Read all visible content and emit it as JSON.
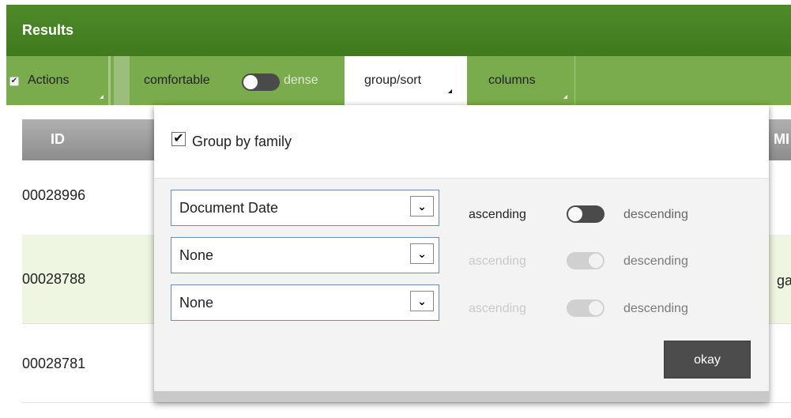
{
  "header": {
    "title": "Results"
  },
  "toolbar": {
    "actions_label": "Actions",
    "density_left": "comfortable",
    "density_right": "dense",
    "tab_group_sort": "group/sort",
    "tab_columns": "columns"
  },
  "table": {
    "id_header": "ID",
    "right_header_partial": "MI",
    "rows": [
      {
        "id": "00028996"
      },
      {
        "id": "00028788",
        "right_partial": "ga"
      },
      {
        "id": "00028781"
      }
    ]
  },
  "popup": {
    "group_by_family": {
      "label": "Group by family",
      "checked": true
    },
    "sort_levels": [
      {
        "field": "Document Date",
        "ascending_label": "ascending",
        "descending_label": "descending",
        "enabled": true
      },
      {
        "field": "None",
        "ascending_label": "ascending",
        "descending_label": "descending",
        "enabled": false
      },
      {
        "field": "None",
        "ascending_label": "ascending",
        "descending_label": "descending",
        "enabled": false
      }
    ],
    "okay_label": "okay"
  },
  "colors": {
    "header_green": "#3f7a1f",
    "toolbar_green": "#7aab4c",
    "row_highlight": "#eef5e1",
    "button_dark": "#4c4c4c"
  }
}
